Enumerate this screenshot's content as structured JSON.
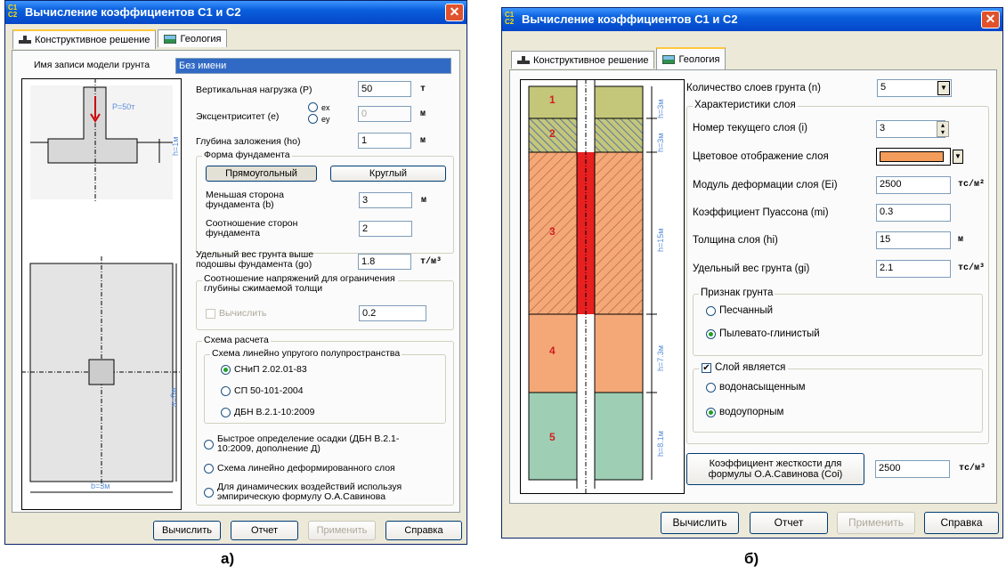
{
  "left": {
    "title": "Вычисление коэффициентов С1 и С2",
    "tabs": [
      "Конструктивное решение",
      "Геология"
    ],
    "model_name_label": "Имя записи модели грунта",
    "model_name_value": "Без имени",
    "drawing": {
      "load": "P=50т",
      "depth": "h=1м",
      "side_a": "a=6м",
      "side_b": "b=3м"
    },
    "vertical_load": {
      "label": "Вертикальная нагрузка (P)",
      "value": "50",
      "unit": "т"
    },
    "eccentricity": {
      "label": "Эксцентриситет (e)",
      "ex": "ex",
      "ey": "ey",
      "value": "0",
      "unit": "м"
    },
    "depth": {
      "label": "Глубина заложения (ho)",
      "value": "1",
      "unit": "м"
    },
    "shape": {
      "group": "Форма фундамента",
      "rect": "Прямоугольный",
      "round": "Круглый"
    },
    "smaller_side": {
      "label": "Меньшая сторона фундамента (b)",
      "value": "3",
      "unit": "м"
    },
    "ratio": {
      "label": "Соотношение сторон фундамента",
      "value": "2"
    },
    "unit_weight": {
      "label": "Удельный вес грунта выше подошвы фундамента (go)",
      "value": "1.8",
      "unit": "т/м³"
    },
    "stress_ratio": {
      "group": "Соотношение напряжений для ограничения глубины сжимаемой толщи",
      "calc": "Вычислить",
      "value": "0.2"
    },
    "scheme": {
      "group": "Схема расчета",
      "sub": "Схема линейно упругого полупространства",
      "opt1": "СНиП 2.02.01-83",
      "opt2": "СП 50-101-2004",
      "opt3": "ДБН В.2.1-10:2009",
      "opt4": "Быстрое определение осадки (ДБН В.2.1-10:2009, дополнение Д)",
      "opt5": "Схема линейно деформированного слоя",
      "opt6": "Для динамических воздействий используя эмпирическую формулу О.А.Савинова"
    },
    "buttons": [
      "Вычислить",
      "Отчет",
      "Применить",
      "Справка"
    ],
    "caption": "а)"
  },
  "right": {
    "title": "Вычисление коэффициентов С1 и С2",
    "tabs": [
      "Конструктивное решение",
      "Геология"
    ],
    "layers": [
      {
        "n": "1",
        "h": "h=3м",
        "color": "#c4c67a"
      },
      {
        "n": "2",
        "h": "h=3м",
        "color": "#3b5cb0"
      },
      {
        "n": "3",
        "h": "h=15м",
        "color": "#f0a070"
      },
      {
        "n": "4",
        "h": "h=7.3м",
        "color": "#f4a878"
      },
      {
        "n": "5",
        "h": "h=8.1м",
        "color": "#9ecfb4"
      }
    ],
    "layer_count": {
      "label": "Количество слоев грунта (n)",
      "value": "5"
    },
    "props_group": "Характеристики слоя",
    "current_layer": {
      "label": "Номер текущего слоя (i)",
      "value": "3"
    },
    "color_label": "Цветовое отображение слоя",
    "layer_color": "#f39c5c",
    "modulus": {
      "label": "Модуль деформации слоя (Ei)",
      "value": "2500",
      "unit": "тс/м²"
    },
    "poisson": {
      "label": "Коэффициент Пуассона (mi)",
      "value": "0.3"
    },
    "thickness": {
      "label": "Толщина слоя (hi)",
      "value": "15",
      "unit": "м"
    },
    "unit_weight": {
      "label": "Удельный вес грунта (gi)",
      "value": "2.1",
      "unit": "тс/м³"
    },
    "soil_type": {
      "group": "Признак грунта",
      "opt1": "Песчанный",
      "opt2": "Пылевато-глинистый"
    },
    "layer_is": {
      "group": "Слой является",
      "opt1": "водонасыщенным",
      "opt2": "водоупорным"
    },
    "stiffness": {
      "button": "Коэффициент жесткости для формулы О.А.Савинова (Coi)",
      "value": "2500",
      "unit": "тс/м³"
    },
    "buttons": [
      "Вычислить",
      "Отчет",
      "Применить",
      "Справка"
    ],
    "caption": "б)"
  }
}
